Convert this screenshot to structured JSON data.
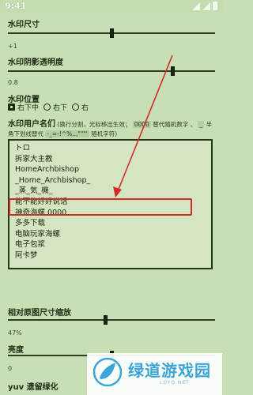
{
  "status": {
    "time": "9:41"
  },
  "watermark_size": {
    "label": "水印尺寸",
    "value": "+1",
    "level": 0.5
  },
  "shadow_opacity": {
    "label": "水印阴影透明度",
    "value": "0.8",
    "level": 0.8
  },
  "position": {
    "label": "水印位置",
    "options": [
      {
        "label": "右下中",
        "checked": true
      },
      {
        "label": "右下",
        "checked": false
      },
      {
        "label": "右",
        "checked": false
      }
    ]
  },
  "username": {
    "label": "水印用户名们",
    "hint_1": "(换行分割，光标移出生效；",
    "hint_code_1": "0000",
    "hint_2": "替代随机数字",
    "hint_line2_a": "、",
    "hint_code_2": "_",
    "hint_line2_b": "半角下划线替代",
    "hint_code_3": "-_=-!^%..,\"\"\"'",
    "hint_line2_c": "随机字符)",
    "names": [
      "トロ",
      "拆家大主教",
      "HomeArchbishop",
      "_Home_Archbishop_",
      "_蒸_気_機_",
      "能不能好好说话",
      "神奇海螺 0000",
      "多多下载",
      "电脑玩家海螺",
      "电子包浆",
      "阿卡梦"
    ]
  },
  "relative_size": {
    "label": "相对原图尺寸缩放",
    "value": "47%",
    "level": 0.47
  },
  "brightness": {
    "label": "亮度",
    "value": "0",
    "level": 0.5
  },
  "yuv": {
    "label": "yuv 遗留绿化"
  },
  "watermark_overlay": {
    "text": "绿道游戏园",
    "sub": "LDYQ.NET"
  },
  "colors": {
    "background": "#c8deb4",
    "highlight": "#d42a2a",
    "accent": "#1e2b13"
  }
}
